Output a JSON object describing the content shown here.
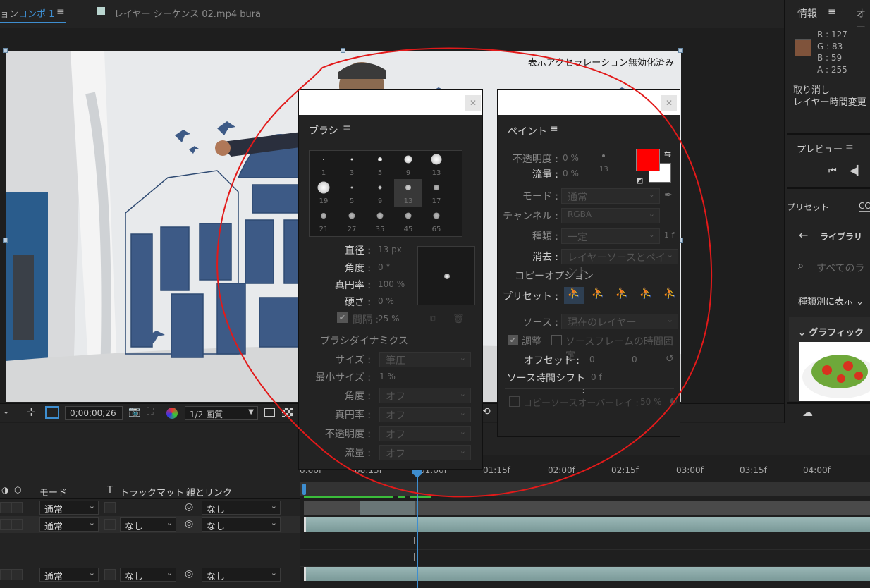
{
  "tabs": {
    "comp_prefix": "ョン",
    "comp_name": "コンポ 1",
    "layer_tab": "レイヤー シーケンス 02.mp4 bura"
  },
  "viewer": {
    "accel_notice": "表示アクセラレーション無効化済み",
    "timecode": "0;00;00;26",
    "quality": "1/2 画質"
  },
  "info_panel": {
    "title": "情報",
    "title2": "オー",
    "r_label": "R :",
    "r": "127",
    "g_label": "G :",
    "g": "83",
    "b_label": "B :",
    "b": "59",
    "a_label": "A :",
    "a": "255",
    "swatch_color": "#7f533b",
    "undo": "取り消し",
    "undo_item": "レイヤー時間変更"
  },
  "preview_panel": {
    "title": "プレビュー"
  },
  "library_panel": {
    "tab_presets": "プリセット",
    "tab_cc": "CC",
    "library_title": "ライブラリ",
    "search_placeholder": "すべてのラ",
    "view_by": "種類別に表示",
    "graphics": "グラフィック"
  },
  "brush_panel": {
    "title": "ブラシ",
    "tips": [
      {
        "size": "1"
      },
      {
        "size": "3"
      },
      {
        "size": "5"
      },
      {
        "size": "9"
      },
      {
        "size": "13"
      },
      {
        "size": "19"
      },
      {
        "size": "5"
      },
      {
        "size": "9"
      },
      {
        "size": "13"
      },
      {
        "size": "17"
      },
      {
        "size": "21"
      },
      {
        "size": "27"
      },
      {
        "size": "35"
      },
      {
        "size": "45"
      },
      {
        "size": "65"
      }
    ],
    "diameter_label": "直径 :",
    "diameter_value": "13 px",
    "angle_label": "角度 :",
    "angle_value": "0 °",
    "roundness_label": "真円率 :",
    "roundness_value": "100 %",
    "hardness_label": "硬さ :",
    "hardness_value": "0 %",
    "spacing_label": "間隔 :",
    "spacing_value": "25 %",
    "dynamics_title": "ブラシダイナミクス",
    "dyn_size_label": "サイズ :",
    "dyn_size_value": "筆圧",
    "dyn_minsize_label": "最小サイズ :",
    "dyn_minsize_value": "1 %",
    "dyn_angle_label": "角度 :",
    "dyn_angle_value": "オフ",
    "dyn_roundness_label": "真円率 :",
    "dyn_roundness_value": "オフ",
    "dyn_opacity_label": "不透明度 :",
    "dyn_opacity_value": "オフ",
    "dyn_flow_label": "流量 :",
    "dyn_flow_value": "オフ"
  },
  "paint_panel": {
    "title": "ペイント",
    "opacity_label": "不透明度 :",
    "opacity_value": "0 %",
    "flow_label": "流量 :",
    "flow_value": "0 %",
    "brush_size": "13",
    "fg_color": "#ff0000",
    "bg_color": "#ffffff",
    "mode_label": "モード :",
    "mode_value": "通常",
    "channel_label": "チャンネル :",
    "channel_value": "RGBA",
    "duration_label": "種類 :",
    "duration_value": "一定",
    "duration_frames": "1 f",
    "erase_label": "消去 :",
    "erase_value": "レイヤーソースとペイント",
    "clone_title": "コピーオプション",
    "preset_label": "プリセット :",
    "source_label": "ソース :",
    "source_value": "現在のレイヤー",
    "aligned_label": "調整",
    "lock_time_label": "ソースフレームの時間固定",
    "offset_label": "オフセット :",
    "offset_x": "0",
    "offset_y": "0",
    "time_shift_label": "ソース時間シフト :",
    "time_shift_value": "0 f",
    "overlay_label": "コピーソースオーバーレイ :",
    "overlay_value": "50 %"
  },
  "timeline": {
    "col_mode": "モード",
    "col_t": "T",
    "col_trackmatte": "トラックマット",
    "col_parent": "親とリンク",
    "ruler": [
      "0:00f",
      "00:15f",
      "01:00f",
      "01:15f",
      "02:00f",
      "02:15f",
      "03:00f",
      "03:15f",
      "04:00f"
    ],
    "layers": [
      {
        "mode": "通常",
        "matte": "",
        "parent": "なし"
      },
      {
        "mode": "通常",
        "matte": "なし",
        "parent": "なし"
      },
      {
        "mode": "通常",
        "matte": "なし",
        "parent": "なし"
      }
    ]
  }
}
